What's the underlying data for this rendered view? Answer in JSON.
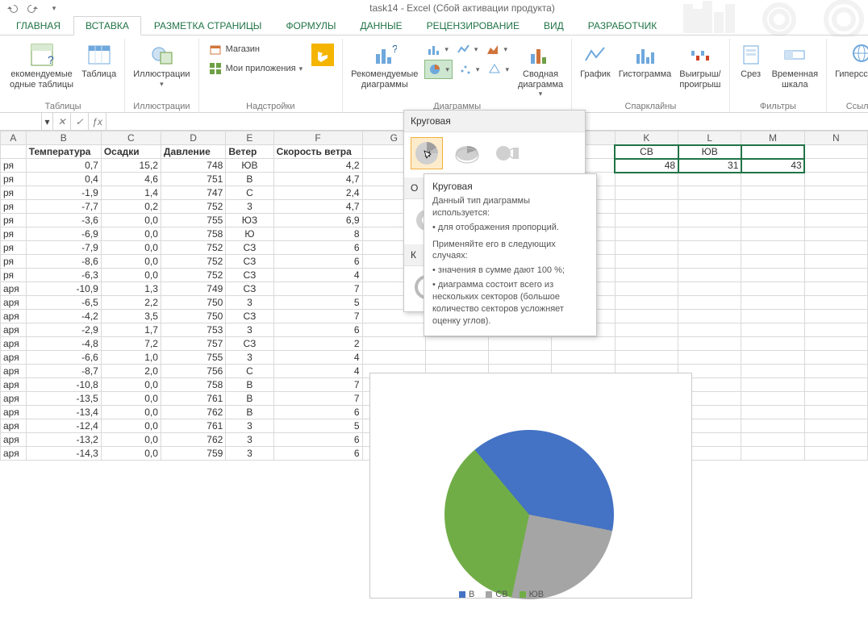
{
  "title": "task14 - Excel (Сбой активации продукта)",
  "tabs": [
    "ГЛАВНАЯ",
    "ВСТАВКА",
    "РАЗМЕТКА СТРАНИЦЫ",
    "ФОРМУЛЫ",
    "ДАННЫЕ",
    "РЕЦЕНЗИРОВАНИЕ",
    "ВИД",
    "РАЗРАБОТЧИК"
  ],
  "active_tab": 1,
  "ribbon": {
    "tables": {
      "label": "Таблицы",
      "pivot_rec": "екомендуемые\nодные таблицы",
      "table": "Таблица"
    },
    "illus": {
      "label": "Иллюстрации",
      "btn": "Иллюстрации"
    },
    "addins": {
      "label": "Надстройки",
      "store": "Магазин",
      "myapps": "Мои приложения"
    },
    "charts": {
      "label": "Диаграммы",
      "rec": "Рекомендуемые\nдиаграммы",
      "pivotchart": "Сводная\nдиаграмма"
    },
    "spark": {
      "label": "Спарклайны",
      "line": "График",
      "col": "Гистограмма",
      "winloss": "Выигрыш/\nпроигрыш"
    },
    "filters": {
      "label": "Фильтры",
      "slicer": "Срез",
      "timeline": "Временная\nшкала"
    },
    "links": {
      "label": "Ссылки",
      "hyper": "Гиперссылка"
    }
  },
  "fx": {
    "name": "",
    "formula": ""
  },
  "columns": [
    "A",
    "B",
    "C",
    "D",
    "E",
    "F",
    "G",
    "H",
    "I",
    "J",
    "K",
    "L",
    "M",
    "N"
  ],
  "headers": {
    "A": "",
    "B": "Температура",
    "C": "Осадки",
    "D": "Давление",
    "E": "Ветер",
    "F": "Скорость ветра"
  },
  "rows": [
    {
      "A": "ря",
      "B": "0,7",
      "C": "15,2",
      "D": "748",
      "E": "ЮВ",
      "F": "4,2"
    },
    {
      "A": "ря",
      "B": "0,4",
      "C": "4,6",
      "D": "751",
      "E": "В",
      "F": "4,7"
    },
    {
      "A": "ря",
      "B": "-1,9",
      "C": "1,4",
      "D": "747",
      "E": "С",
      "F": "2,4"
    },
    {
      "A": "ря",
      "B": "-7,7",
      "C": "0,2",
      "D": "752",
      "E": "3",
      "F": "4,7"
    },
    {
      "A": "ря",
      "B": "-3,6",
      "C": "0,0",
      "D": "755",
      "E": "ЮЗ",
      "F": "6,9"
    },
    {
      "A": "ря",
      "B": "-6,9",
      "C": "0,0",
      "D": "758",
      "E": "Ю",
      "F": "8"
    },
    {
      "A": "ря",
      "B": "-7,9",
      "C": "0,0",
      "D": "752",
      "E": "СЗ",
      "F": "6"
    },
    {
      "A": "ря",
      "B": "-8,6",
      "C": "0,0",
      "D": "752",
      "E": "СЗ",
      "F": "6"
    },
    {
      "A": "ря",
      "B": "-6,3",
      "C": "0,0",
      "D": "752",
      "E": "СЗ",
      "F": "4"
    },
    {
      "A": "аря",
      "B": "-10,9",
      "C": "1,3",
      "D": "749",
      "E": "СЗ",
      "F": "7"
    },
    {
      "A": "аря",
      "B": "-6,5",
      "C": "2,2",
      "D": "750",
      "E": "3",
      "F": "5"
    },
    {
      "A": "аря",
      "B": "-4,2",
      "C": "3,5",
      "D": "750",
      "E": "СЗ",
      "F": "7"
    },
    {
      "A": "аря",
      "B": "-2,9",
      "C": "1,7",
      "D": "753",
      "E": "3",
      "F": "6"
    },
    {
      "A": "аря",
      "B": "-4,8",
      "C": "7,2",
      "D": "757",
      "E": "СЗ",
      "F": "2"
    },
    {
      "A": "аря",
      "B": "-6,6",
      "C": "1,0",
      "D": "755",
      "E": "3",
      "F": "4"
    },
    {
      "A": "аря",
      "B": "-8,7",
      "C": "2,0",
      "D": "756",
      "E": "С",
      "F": "4"
    },
    {
      "A": "аря",
      "B": "-10,8",
      "C": "0,0",
      "D": "758",
      "E": "В",
      "F": "7"
    },
    {
      "A": "аря",
      "B": "-13,5",
      "C": "0,0",
      "D": "761",
      "E": "В",
      "F": "7"
    },
    {
      "A": "аря",
      "B": "-13,4",
      "C": "0,0",
      "D": "762",
      "E": "В",
      "F": "6"
    },
    {
      "A": "аря",
      "B": "-12,4",
      "C": "0,0",
      "D": "761",
      "E": "3",
      "F": "5"
    },
    {
      "A": "аря",
      "B": "-13,2",
      "C": "0,0",
      "D": "762",
      "E": "3",
      "F": "6"
    },
    {
      "A": "аря",
      "B": "-14,3",
      "C": "0,0",
      "D": "759",
      "E": "3",
      "F": "6"
    }
  ],
  "extra_header_row": {
    "K": "СВ",
    "L": "ЮВ",
    "M": ""
  },
  "extra_data_row": {
    "K": "48",
    "L": "31",
    "M": "43"
  },
  "drop": {
    "section1": "Круговая",
    "section2_prefix": "О",
    "section3_prefix": "К"
  },
  "tooltip": {
    "title": "Круговая",
    "l1": "Данный тип диаграммы используется:",
    "l2": "• для отображения пропорций.",
    "l3": "Применяйте его в следующих случаях:",
    "l4": "• значения в сумме дают 100 %;",
    "l5": "• диаграмма состоит всего из нескольких секторов (большое количество секторов усложняет оценку углов)."
  },
  "chart_data": {
    "type": "pie",
    "title": "",
    "series": [
      {
        "name": "В",
        "value": 48,
        "color": "#4472C4"
      },
      {
        "name": "СВ",
        "value": 31,
        "color": "#A5A5A5"
      },
      {
        "name": "ЮВ",
        "value": 43,
        "color": "#70AD47"
      }
    ],
    "legend_labels": [
      "В",
      "СВ",
      "ЮВ"
    ]
  }
}
